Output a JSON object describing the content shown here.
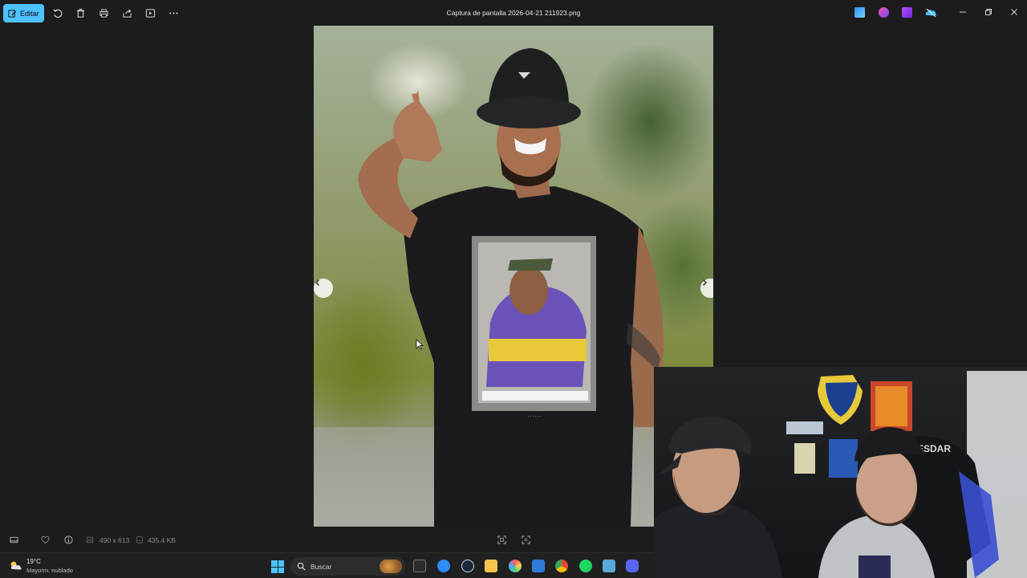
{
  "toolbar": {
    "edit_label": "Editar",
    "icons": [
      "edit-icon",
      "rotate-icon",
      "delete-icon",
      "print-icon",
      "share-icon",
      "slideshow-icon",
      "more-icon"
    ]
  },
  "window": {
    "title": "Captura de pantalla 2026-04-21 211923.png"
  },
  "extensions": [
    "snipping-tool-icon",
    "copilot-icon",
    "clipchamp-icon",
    "onedrive-icon"
  ],
  "statusbar": {
    "dimensions": "490 x 613",
    "file_size": "435.4 KB"
  },
  "taskbar": {
    "weather": {
      "temp": "19°C",
      "condition": "Mayorm. nublado"
    },
    "search_placeholder": "Buscar",
    "apps": [
      "file-explorer-icon",
      "zoom-icon",
      "steam-icon",
      "folder-icon",
      "photos-icon",
      "store-icon",
      "chrome-icon",
      "spotify-icon",
      "snipping-icon",
      "discord-icon"
    ]
  },
  "colors": {
    "accent": "#4cc2ff",
    "background": "#1c1c1c",
    "taskbar": "#202020"
  }
}
